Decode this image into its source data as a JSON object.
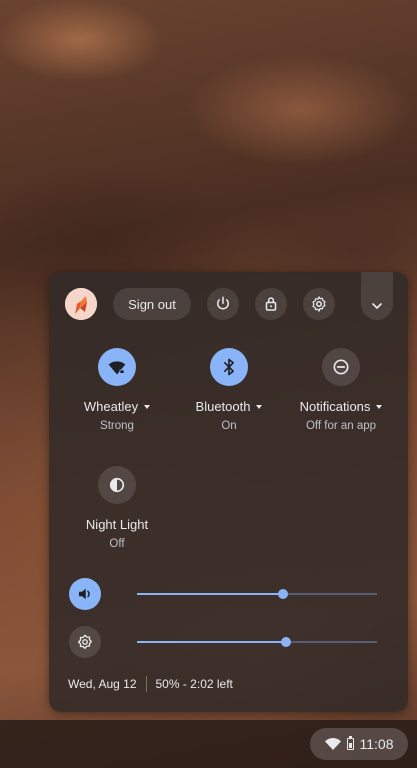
{
  "user": {
    "avatar_icon": "user-avatar"
  },
  "top_row": {
    "sign_out_label": "Sign out",
    "icons": [
      "power-icon",
      "lock-icon",
      "settings-icon",
      "chevron-down-icon"
    ]
  },
  "tiles": [
    {
      "label": "Wheatley",
      "status": "Strong",
      "icon": "wifi-icon",
      "active": true,
      "has_menu": true
    },
    {
      "label": "Bluetooth",
      "status": "On",
      "icon": "bluetooth-icon",
      "active": true,
      "has_menu": true
    },
    {
      "label": "Notifications",
      "status": "Off for an app",
      "icon": "do-not-disturb-icon",
      "active": false,
      "has_menu": true
    },
    {
      "label": "Night Light",
      "status": "Off",
      "icon": "night-light-icon",
      "active": false,
      "has_menu": false
    }
  ],
  "sliders": {
    "volume": {
      "icon": "volume-icon",
      "level": 0.61
    },
    "brightness": {
      "icon": "brightness-icon",
      "level": 0.62
    }
  },
  "footer": {
    "date": "Wed, Aug 12",
    "battery": "50% - 2:02 left"
  },
  "shelf": {
    "time": "11:08"
  },
  "colors": {
    "accent": "#8ab4f8",
    "panel": "#322a28"
  }
}
